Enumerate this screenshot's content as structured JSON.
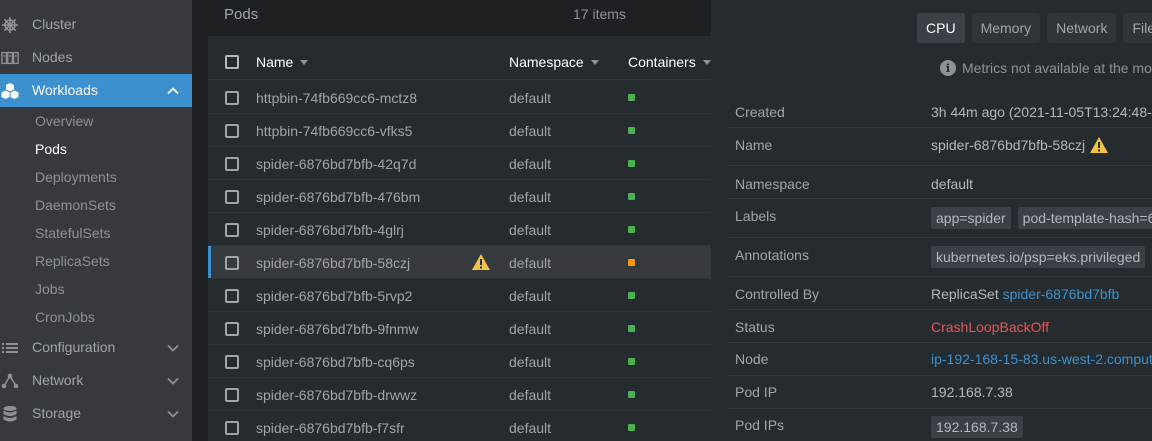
{
  "sidebar": {
    "items": [
      {
        "label": "Cluster",
        "icon": "helm-wheel-icon"
      },
      {
        "label": "Nodes",
        "icon": "server-rack-icon"
      },
      {
        "label": "Workloads",
        "icon": "cubes-icon"
      },
      {
        "label": "Configuration",
        "icon": "list-icon"
      },
      {
        "label": "Network",
        "icon": "network-icon"
      },
      {
        "label": "Storage",
        "icon": "database-icon"
      }
    ],
    "workloads_sub": [
      "Overview",
      "Pods",
      "Deployments",
      "DaemonSets",
      "StatefulSets",
      "ReplicaSets",
      "Jobs",
      "CronJobs"
    ]
  },
  "pods": {
    "title": "Pods",
    "count": "17 items",
    "columns": {
      "name": "Name",
      "namespace": "Namespace",
      "containers": "Containers"
    },
    "rows": [
      {
        "name": "httpbin-74fb669cc6-mctz8",
        "namespace": "default",
        "status": "ok"
      },
      {
        "name": "httpbin-74fb669cc6-vfks5",
        "namespace": "default",
        "status": "ok"
      },
      {
        "name": "spider-6876bd7bfb-42q7d",
        "namespace": "default",
        "status": "ok"
      },
      {
        "name": "spider-6876bd7bfb-476bm",
        "namespace": "default",
        "status": "ok"
      },
      {
        "name": "spider-6876bd7bfb-4glrj",
        "namespace": "default",
        "status": "ok"
      },
      {
        "name": "spider-6876bd7bfb-58czj",
        "namespace": "default",
        "status": "warn"
      },
      {
        "name": "spider-6876bd7bfb-5rvp2",
        "namespace": "default",
        "status": "ok"
      },
      {
        "name": "spider-6876bd7bfb-9fnmw",
        "namespace": "default",
        "status": "ok"
      },
      {
        "name": "spider-6876bd7bfb-cq6ps",
        "namespace": "default",
        "status": "ok"
      },
      {
        "name": "spider-6876bd7bfb-drwwz",
        "namespace": "default",
        "status": "ok"
      },
      {
        "name": "spider-6876bd7bfb-f7sfr",
        "namespace": "default",
        "status": "ok"
      }
    ]
  },
  "details": {
    "tabs": [
      "CPU",
      "Memory",
      "Network",
      "File"
    ],
    "metrics_note": "Metrics not available at the mo",
    "fields": {
      "created_label": "Created",
      "created_value": "3h 44m ago (2021-11-05T13:24:48-0",
      "name_label": "Name",
      "name_value": "spider-6876bd7bfb-58czj",
      "namespace_label": "Namespace",
      "namespace_value": "default",
      "labels_label": "Labels",
      "labels": [
        "app=spider",
        "pod-template-hash=6"
      ],
      "annotations_label": "Annotations",
      "annotations": [
        "kubernetes.io/psp=eks.privileged"
      ],
      "controlled_by_label": "Controlled By",
      "controlled_by_kind": "ReplicaSet",
      "controlled_by_link": "spider-6876bd7bfb",
      "status_label": "Status",
      "status_value": "CrashLoopBackOff",
      "node_label": "Node",
      "node_value": "ip-192-168-15-83.us-west-2.comput",
      "pod_ip_label": "Pod IP",
      "pod_ip_value": "192.168.7.38",
      "pod_ips_label": "Pod IPs",
      "pod_ips_value": "192.168.7.38"
    }
  },
  "colors": {
    "accent": "#3d90ce",
    "ok": "#4caf50",
    "warn": "#ff9800",
    "error": "#e85555"
  }
}
